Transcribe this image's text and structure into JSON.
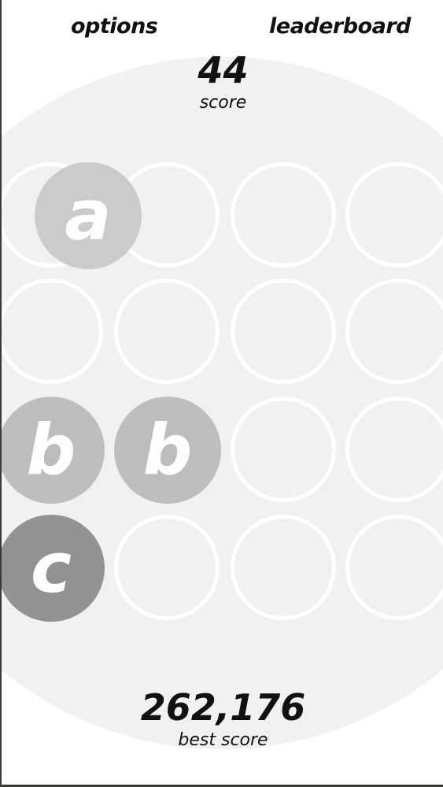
{
  "header": {
    "options_label": "options",
    "leaderboard_label": "leaderboard"
  },
  "score": {
    "value": "44",
    "label": "score"
  },
  "best_score": {
    "value": "262,176",
    "label": "best score"
  },
  "colors": {
    "background": "#ffffff",
    "board_circle": "#f1f1f1",
    "slot_ring": "#ffffff",
    "piece_a": "#c8c8c8",
    "piece_b": "#b9b9b9",
    "piece_c": "#8a8a8a",
    "text": "#111111"
  },
  "grid": {
    "rows": 4,
    "cols": 4
  },
  "pieces": [
    {
      "letter": "a",
      "row": 0,
      "col": 0,
      "shade": "piece_a"
    },
    {
      "letter": "b",
      "row": 2,
      "col": 0,
      "shade": "piece_b"
    },
    {
      "letter": "b",
      "row": 2,
      "col": 1,
      "shade": "piece_b"
    },
    {
      "letter": "c",
      "row": 3,
      "col": 0,
      "shade": "piece_c"
    }
  ]
}
